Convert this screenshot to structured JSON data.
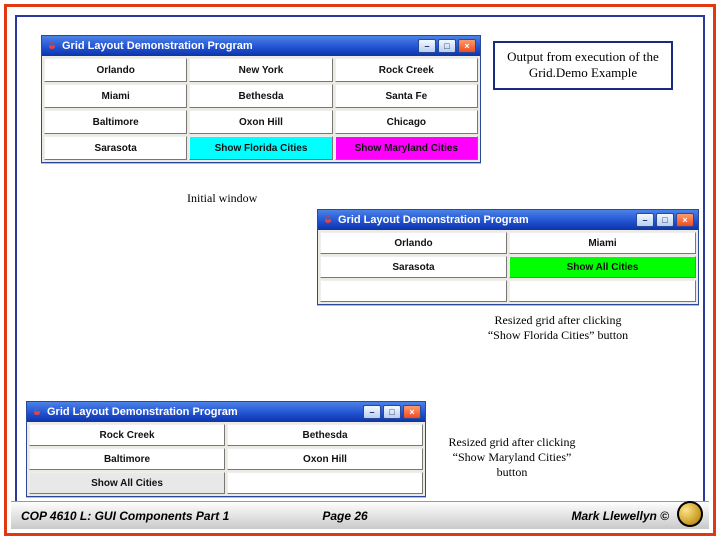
{
  "slide": {
    "callout_top": "Output from execution of the Grid.Demo Example",
    "label_initial": "Initial window",
    "label_resized1": "Resized grid after clicking “Show Florida Cities” button",
    "label_resized2": "Resized grid after clicking “Show Maryland Cities” button"
  },
  "windows": {
    "title": "Grid Layout Demonstration Program",
    "win_min": "–",
    "win_max": "□",
    "win_close": "×",
    "win1_cells": [
      "Orlando",
      "New York",
      "Rock Creek",
      "Miami",
      "Bethesda",
      "Santa Fe",
      "Baltimore",
      "Oxon Hill",
      "Chicago",
      "Sarasota",
      "Show Florida Cities",
      "Show Maryland Cities"
    ],
    "win2_cells": [
      "Orlando",
      "Miami",
      "Sarasota",
      "Show All Cities"
    ],
    "win3_cells": [
      "Rock Creek",
      "Bethesda",
      "Baltimore",
      "Oxon Hill",
      "Show All Cities"
    ]
  },
  "footer": {
    "left": "COP 4610 L: GUI Components Part 1",
    "center": "Page 26",
    "right": "Mark Llewellyn ©"
  }
}
